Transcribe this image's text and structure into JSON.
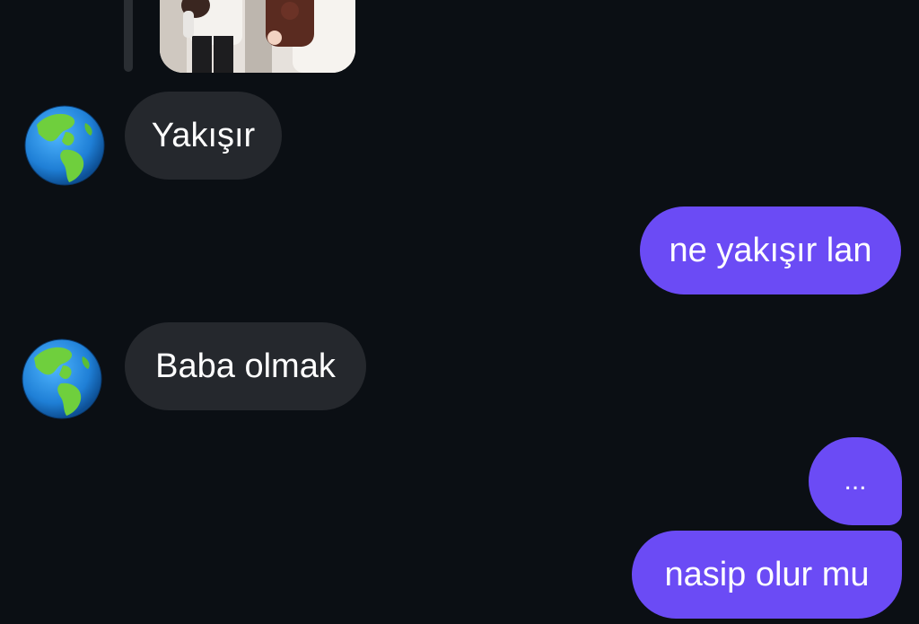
{
  "conversation": {
    "messages": [
      {
        "direction": "incoming",
        "text": "Yakışır",
        "avatar_icon": "earth-globe-americas-icon"
      },
      {
        "direction": "outgoing",
        "text": "ne yakışır lan"
      },
      {
        "direction": "incoming",
        "text": "Baba olmak",
        "avatar_icon": "earth-globe-americas-icon"
      },
      {
        "direction": "outgoing",
        "text": "..."
      },
      {
        "direction": "outgoing",
        "text": "nasip olur mu"
      }
    ]
  },
  "theme": {
    "background": "#0b0f14",
    "incoming_bubble": "#25282d",
    "outgoing_bubble": "#6b4bf5",
    "text": "#ffffff"
  }
}
